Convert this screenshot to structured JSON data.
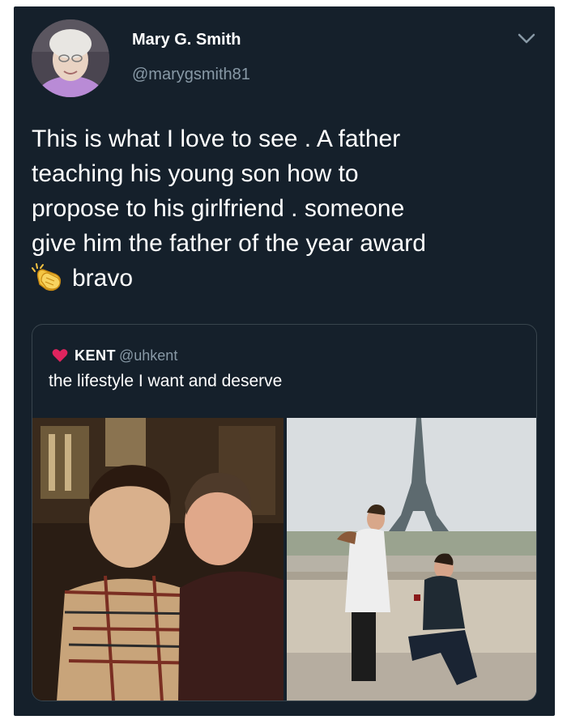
{
  "tweet": {
    "author_name": "Mary G. Smith",
    "author_handle": "@marygsmith81",
    "text_line1": "This is what I love to see . A father",
    "text_line2": "teaching his young son how to",
    "text_line3": "propose to his girlfriend . someone",
    "text_line4": "give him the father of the year award",
    "text_line5": "bravo",
    "emoji": "clapping-hands-icon"
  },
  "quoted_tweet": {
    "author_name": "KENT",
    "author_handle": "@uhkent",
    "text": "the lifestyle I want and deserve",
    "name_emoji": "red-heart-icon"
  },
  "colors": {
    "background": "#15202b",
    "primary_text": "#ffffff",
    "secondary_text": "#8899a6",
    "border": "#38444d",
    "heart": "#e0245e"
  }
}
